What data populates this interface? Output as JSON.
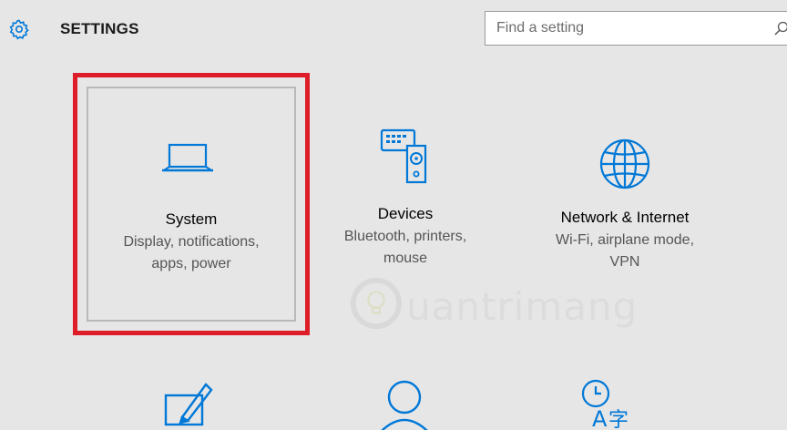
{
  "header": {
    "title": "SETTINGS",
    "search_placeholder": "Find a setting"
  },
  "tiles": [
    {
      "title": "System",
      "desc_line1": "Display, notifications,",
      "desc_line2": "apps, power",
      "icon": "laptop-icon",
      "selected": true
    },
    {
      "title": "Devices",
      "desc_line1": "Bluetooth, printers,",
      "desc_line2": "mouse",
      "icon": "devices-icon"
    },
    {
      "title": "Network & Internet",
      "desc_line1": "Wi-Fi, airplane mode,",
      "desc_line2": "VPN",
      "icon": "globe-icon"
    }
  ],
  "bottom_tiles": [
    {
      "icon": "personalization-icon"
    },
    {
      "icon": "accounts-icon"
    },
    {
      "icon": "time-language-icon"
    }
  ],
  "watermark": {
    "text": "uantrimang"
  },
  "colors": {
    "accent": "#0078d7",
    "selection": "#dd1e28",
    "background": "#e6e6e6"
  }
}
